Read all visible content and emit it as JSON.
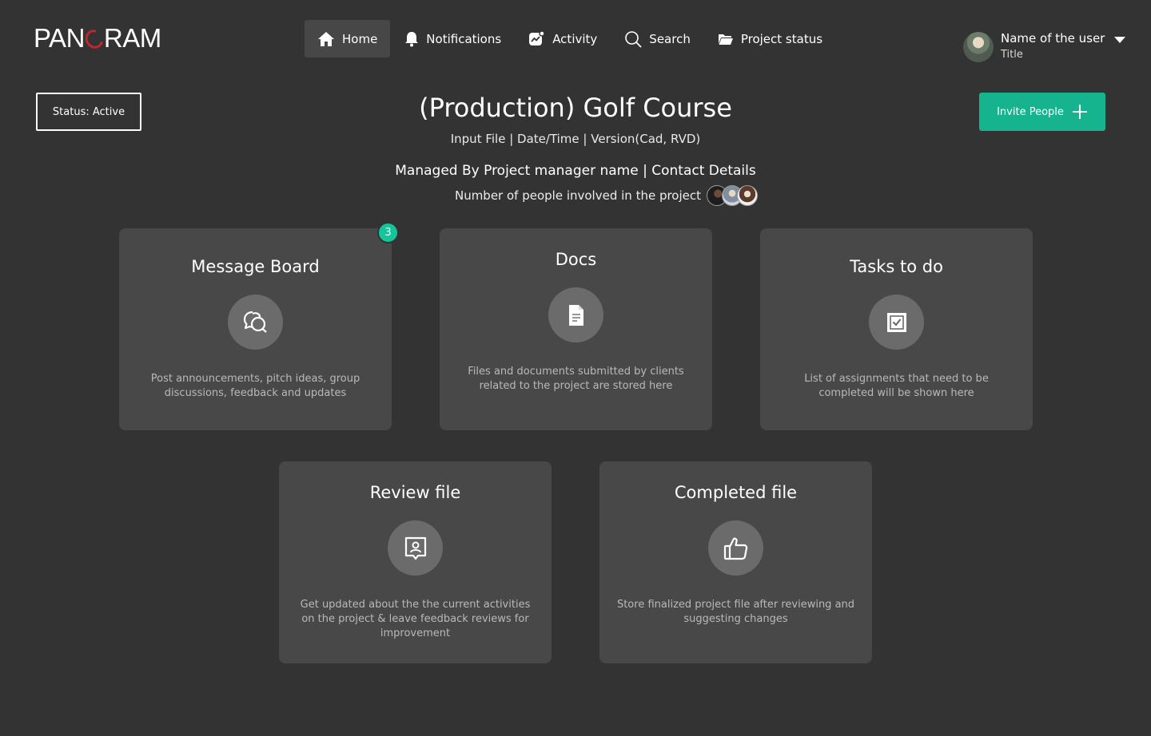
{
  "brand": {
    "logo_text_left": "PAN",
    "logo_text_right": "RAM",
    "logo_accent": "#c0272d"
  },
  "nav": {
    "items": [
      {
        "label": "Home",
        "icon": "home-icon",
        "active": true
      },
      {
        "label": "Notifications",
        "icon": "bell-icon",
        "active": false
      },
      {
        "label": "Activity",
        "icon": "activity-icon",
        "active": false
      },
      {
        "label": "Search",
        "icon": "search-icon",
        "active": false
      },
      {
        "label": "Project status",
        "icon": "folder-icon",
        "active": false
      }
    ]
  },
  "user": {
    "name": "Name of the user",
    "title": "Title"
  },
  "status": {
    "label": "Status: Active"
  },
  "invite": {
    "label": "Invite People",
    "color": "#15b38e"
  },
  "project": {
    "title": "(Production) Golf Course",
    "meta": "Input File | Date/Time | Version(Cad, RVD)",
    "managed_by": "Managed By Project manager name | Contact Details",
    "people_label": "Number of people involved in the project"
  },
  "cards": [
    {
      "title": "Message Board",
      "icon": "chat-bubbles-icon",
      "badge": "3",
      "desc": "Post announcements, pitch ideas, group discussions, feedback and updates"
    },
    {
      "title": "Docs",
      "icon": "document-icon",
      "desc": "Files and documents submitted by clients related to the project are stored here"
    },
    {
      "title": "Tasks to do",
      "icon": "checkbox-icon",
      "desc": "List of assignments that need to be completed will be shown here"
    },
    {
      "title": "Review file",
      "icon": "review-user-icon",
      "desc": "Get updated about the the current activities on the project & leave feedback reviews for improvement"
    },
    {
      "title": "Completed file",
      "icon": "thumbs-up-icon",
      "desc": "Store finalized project file after reviewing and suggesting changes"
    }
  ],
  "colors": {
    "background": "#333333",
    "card": "#484848",
    "badge": "#15c49a"
  }
}
